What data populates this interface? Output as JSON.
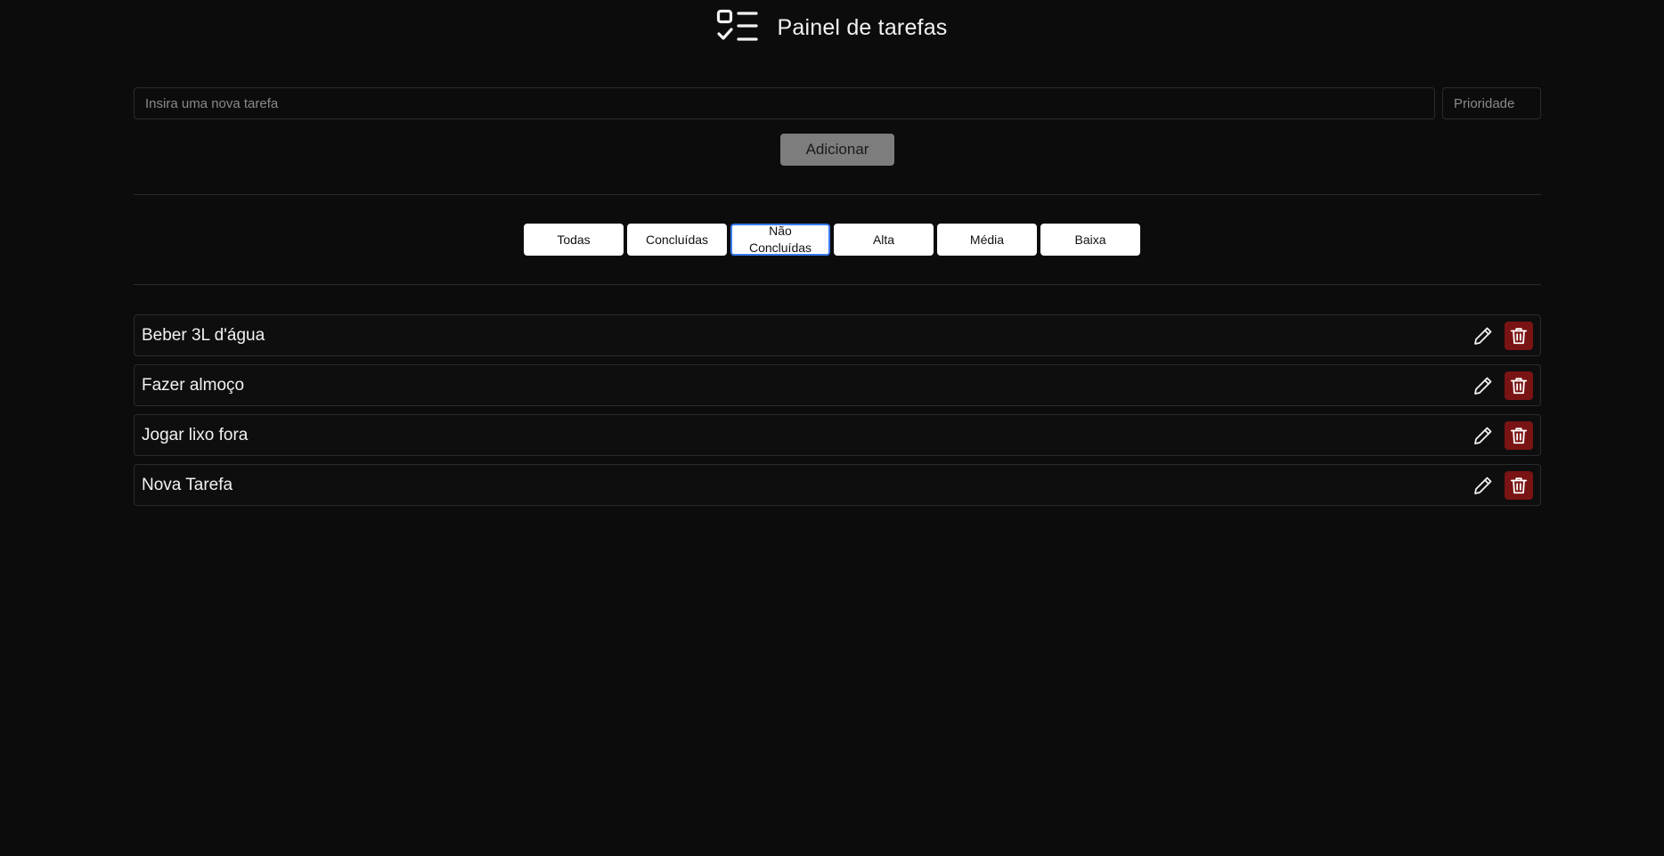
{
  "header": {
    "title": "Painel de tarefas",
    "logo_icon": "checklist-icon"
  },
  "form": {
    "task_placeholder": "Insira uma nova tarefa",
    "task_value": "",
    "priority_placeholder": "Prioridade",
    "priority_value": "",
    "add_label": "Adicionar"
  },
  "filters": {
    "all": "Todas",
    "done": "Concluídas",
    "not_done": "Não Concluídas",
    "high": "Alta",
    "medium": "Média",
    "low": "Baixa",
    "active": "not_done"
  },
  "tasks": [
    {
      "text": "Beber 3L d'água"
    },
    {
      "text": "Fazer almoço"
    },
    {
      "text": "Jogar lixo fora"
    },
    {
      "text": "Nova Tarefa"
    }
  ],
  "colors": {
    "background": "#0c0c0d",
    "accent_focus": "#3b7bf0",
    "delete": "#7a1313",
    "add_button": "#7d7d7d"
  },
  "icons": {
    "edit": "pencil-icon",
    "delete": "trash-icon"
  }
}
